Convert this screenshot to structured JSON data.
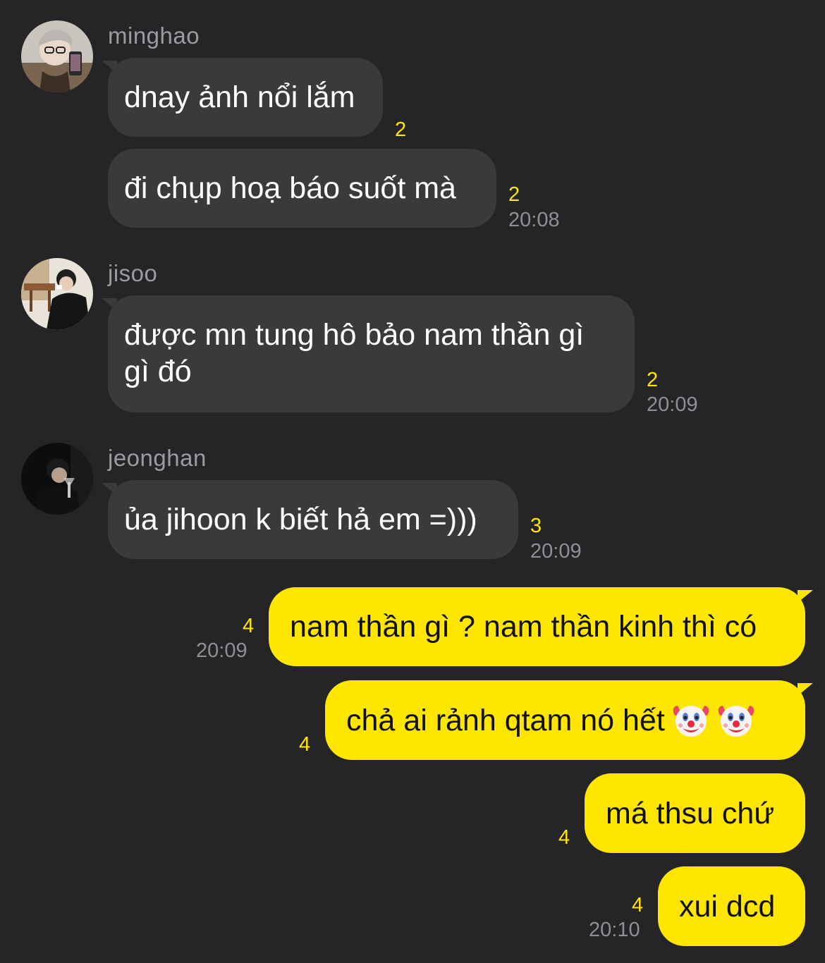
{
  "messages": [
    {
      "sender": "minghao",
      "avatar_icon": "avatar-photo-glasses-selfie",
      "bubbles": [
        {
          "text": "dnay ảnh nổi lắm",
          "count": "2"
        },
        {
          "text": "đi chụp hoạ báo suốt mà",
          "count": "2",
          "time": "20:08"
        }
      ]
    },
    {
      "sender": "jisoo",
      "avatar_icon": "avatar-photo-cafe",
      "bubbles": [
        {
          "text": "được mn tung hô bảo nam thần gì gì đó",
          "count": "2",
          "time": "20:09"
        }
      ]
    },
    {
      "sender": "jeonghan",
      "avatar_icon": "avatar-photo-dark-portrait",
      "bubbles": [
        {
          "text": "ủa jihoon k biết hả em =)))",
          "count": "3",
          "time": "20:09"
        }
      ]
    },
    {
      "sender": "me",
      "bubbles": [
        {
          "text": "nam thần gì ? nam thần kinh thì có",
          "count": "4",
          "time": "20:09"
        },
        {
          "text": "chả ai rảnh qtam nó hết",
          "emoji": "🤡🤡",
          "count": "4"
        },
        {
          "text": "má thsu chứ",
          "count": "4"
        },
        {
          "text": "xui dcd",
          "count": "4",
          "time": "20:10"
        }
      ]
    }
  ],
  "colors": {
    "background": "#252527",
    "incoming_bubble": "#3a3a3c",
    "outgoing_bubble": "#ffe600",
    "unread_count": "#ffe600",
    "timestamp": "#8e8e93",
    "sender_name": "#9b9ba0"
  }
}
